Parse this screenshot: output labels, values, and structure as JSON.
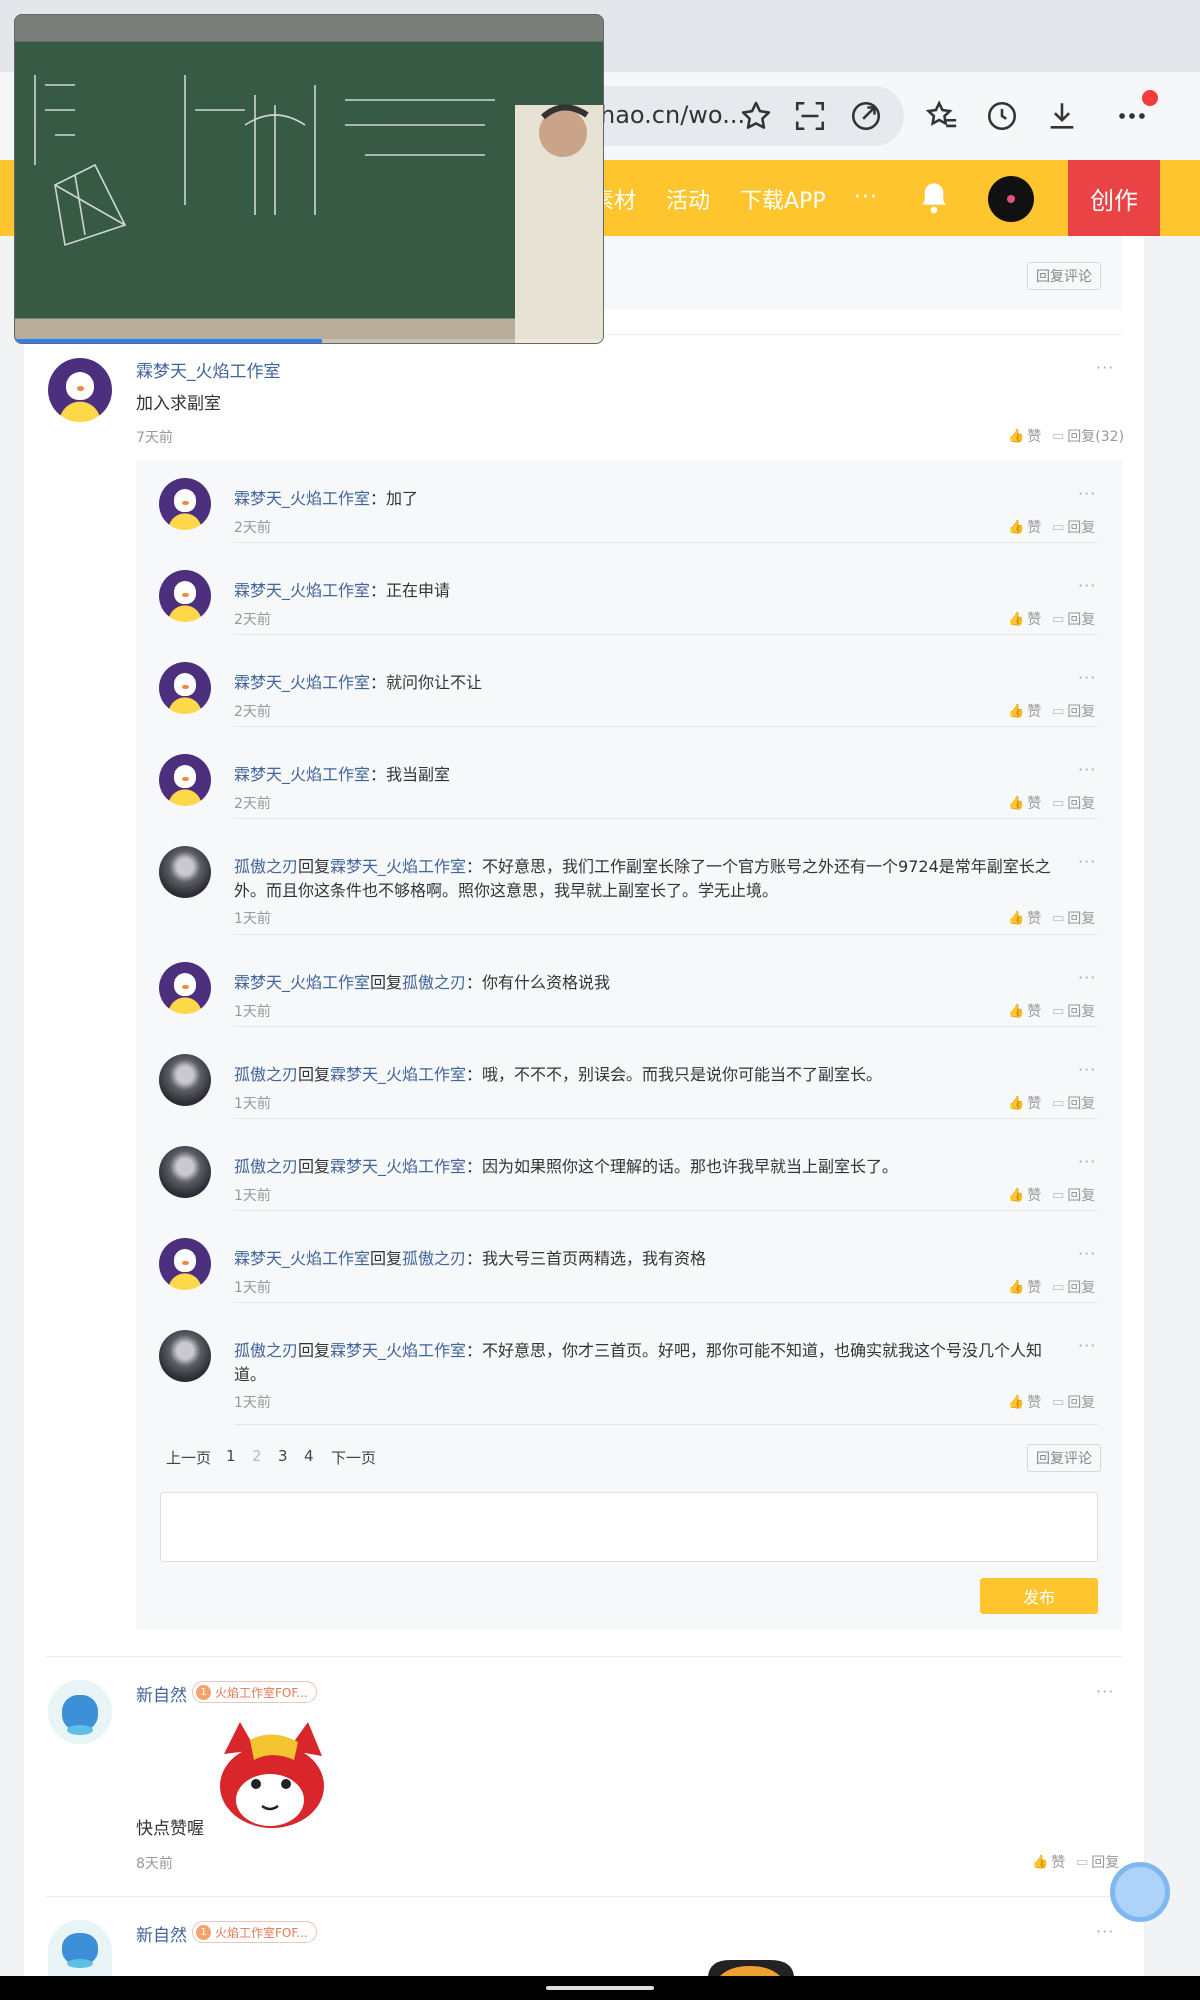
{
  "browser": {
    "url_partial": "hao.cn/wo..."
  },
  "site_header": {
    "nav": [
      "素材",
      "活动",
      "下载APP"
    ],
    "more": "···",
    "create_label": "创作"
  },
  "prev_comment": {
    "reply_comment_label": "回复评论"
  },
  "comment1": {
    "user": "霖梦天_火焰工作室",
    "text": "加入求副室",
    "time": "7天前",
    "like_label": "赞",
    "reply_label": "回复(32)",
    "replies": [
      {
        "user": "霖梦天_火焰工作室",
        "text": "：加了",
        "time": "2天前"
      },
      {
        "user": "霖梦天_火焰工作室",
        "text": "：正在申请",
        "time": "2天前"
      },
      {
        "user": "霖梦天_火焰工作室",
        "text": "：就问你让不让",
        "time": "2天前"
      },
      {
        "user": "霖梦天_火焰工作室",
        "text": "：我当副室",
        "time": "2天前"
      },
      {
        "user": "孤傲之刃",
        "reply_word": "回复",
        "target": "霖梦天_火焰工作室",
        "text": "：不好意思，我们工作副室长除了一个官方账号之外还有一个9724是常年副室长之外。而且你这条件也不够格啊。照你这意思，我早就上副室长了。学无止境。",
        "time": "1天前"
      },
      {
        "user": "霖梦天_火焰工作室",
        "reply_word": "回复",
        "target": "孤傲之刃",
        "text": "：你有什么资格说我",
        "time": "1天前"
      },
      {
        "user": "孤傲之刃",
        "reply_word": "回复",
        "target": "霖梦天_火焰工作室",
        "text": "：哦，不不不，别误会。而我只是说你可能当不了副室长。",
        "time": "1天前"
      },
      {
        "user": "孤傲之刃",
        "reply_word": "回复",
        "target": "霖梦天_火焰工作室",
        "text": "：因为如果照你这个理解的话。那也许我早就当上副室长了。",
        "time": "1天前"
      },
      {
        "user": "霖梦天_火焰工作室",
        "reply_word": "回复",
        "target": "孤傲之刃",
        "text": "：我大号三首页两精选，我有资格",
        "time": "1天前"
      },
      {
        "user": "孤傲之刃",
        "reply_word": "回复",
        "target": "霖梦天_火焰工作室",
        "text": "：不好意思，你才三首页。好吧，那你可能不知道，也确实就我这个号没几个人知道。",
        "time": "1天前"
      }
    ],
    "reply_like_label": "赞",
    "reply_reply_label": "回复",
    "pager": {
      "prev": "上一页",
      "pages": [
        "1",
        "2",
        "3",
        "4"
      ],
      "current": "2",
      "next": "下一页"
    },
    "reply_comment_label": "回复评论",
    "publish_label": "发布"
  },
  "comment2": {
    "user": "新自然",
    "badge_level": "1",
    "badge_text": "火焰工作室FOF...",
    "text": "快点赞喔",
    "time": "8天前",
    "like_label": "赞",
    "reply_label": "回复"
  },
  "comment3": {
    "user": "新自然",
    "badge_level": "1",
    "badge_text": "火焰工作室FOF..."
  },
  "video": {
    "progress_fraction": 0.52
  }
}
